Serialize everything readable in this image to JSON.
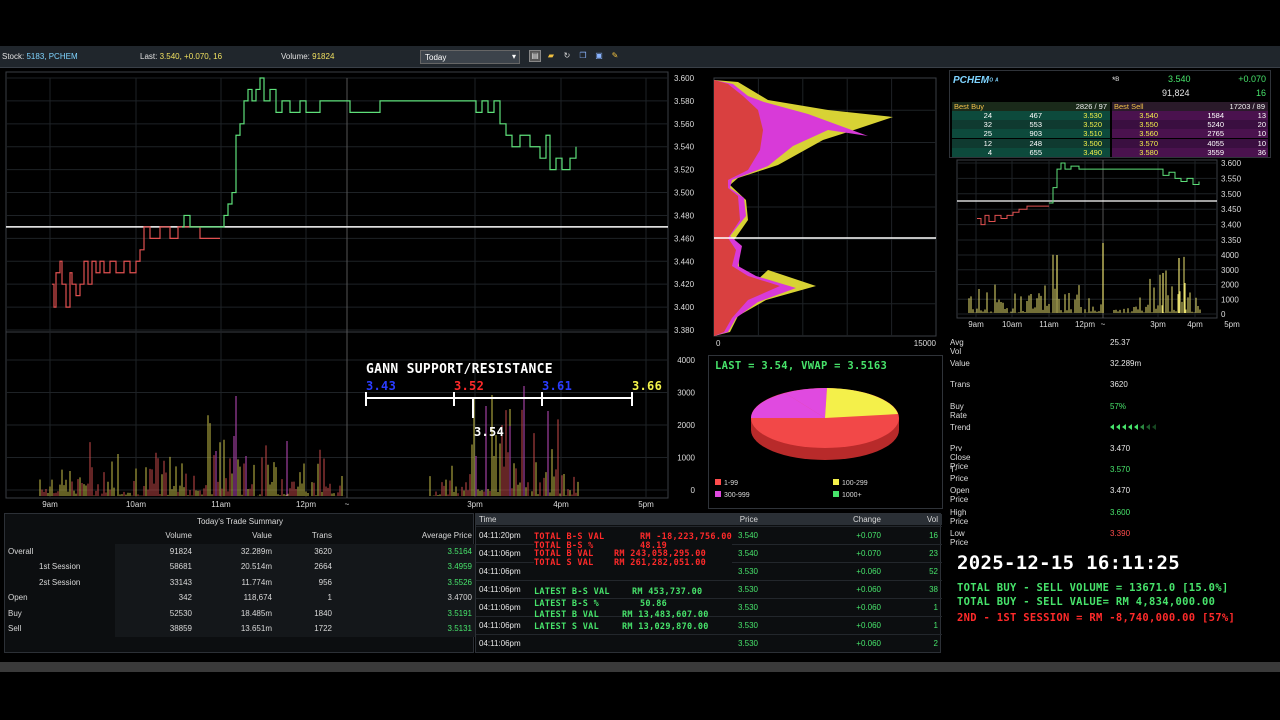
{
  "header": {
    "stock_label": "Stock:",
    "stock_value": "5183,  PCHEM",
    "last_label": "Last:",
    "last_value": "3.540, +0.070, 16",
    "volume_label": "Volume:",
    "volume_value": "91824",
    "period_select": "Today"
  },
  "main_chart": {
    "price_ticks": [
      "3.600",
      "3.580",
      "3.560",
      "3.540",
      "3.520",
      "3.500",
      "3.480",
      "3.460",
      "3.440",
      "3.420",
      "3.400",
      "3.380"
    ],
    "volume_ticks": [
      "4000",
      "3000",
      "2000",
      "1000",
      "0"
    ],
    "time_ticks": [
      "9am",
      "10am",
      "11am",
      "12pm",
      "~",
      "3pm",
      "4pm",
      "5pm"
    ],
    "reference_price": 3.47
  },
  "gann": {
    "title": "GANN SUPPORT/RESISTANCE",
    "levels": [
      "3.43",
      "3.52",
      "3.61",
      "3.66"
    ],
    "current": "3.54",
    "colors": {
      "level1": "#2a3cff",
      "level2": "#ff2a2a",
      "level3": "#2a3cff",
      "level4": "#f2f24a"
    }
  },
  "volume_profile": {
    "x_ticks": [
      "0",
      "15000"
    ]
  },
  "pie": {
    "title": "LAST = 3.54, VWAP = 3.5163",
    "legend": [
      {
        "label": "1-99",
        "color": "#ff4d4d"
      },
      {
        "label": "100-299",
        "color": "#f4f04a"
      },
      {
        "label": "300-999",
        "color": "#e04ae0"
      },
      {
        "label": "1000+",
        "color": "#47e36b"
      }
    ]
  },
  "summary": {
    "title": "Today's Trade Summary",
    "columns": [
      "",
      "Volume",
      "Value",
      "Trans",
      "Average Price"
    ],
    "rows": [
      {
        "label": "Overall",
        "volume": "91824",
        "value": "32.289m",
        "trans": "3620",
        "avg": "3.5164"
      },
      {
        "label": "1st Session",
        "volume": "58681",
        "value": "20.514m",
        "trans": "2664",
        "avg": "3.4959"
      },
      {
        "label": "2st Session",
        "volume": "33143",
        "value": "11.774m",
        "trans": "956",
        "avg": "3.5526"
      },
      {
        "label": "Open",
        "volume": "342",
        "value": "118,674",
        "trans": "1",
        "avg": "3.4700"
      },
      {
        "label": "Buy",
        "volume": "52530",
        "value": "18.485m",
        "trans": "1840",
        "avg": "3.5191"
      },
      {
        "label": "Sell",
        "volume": "38859",
        "value": "13.651m",
        "trans": "1722",
        "avg": "3.5131"
      }
    ]
  },
  "trades": {
    "columns": [
      "Time",
      "Price",
      "Change",
      "Vol"
    ],
    "rows": [
      {
        "time": "04:11:20pm",
        "price": "3.540",
        "change": "+0.070",
        "vol": "16"
      },
      {
        "time": "04:11:06pm",
        "price": "3.540",
        "change": "+0.070",
        "vol": "23"
      },
      {
        "time": "04:11:06pm",
        "price": "3.530",
        "change": "+0.060",
        "vol": "52"
      },
      {
        "time": "04:11:06pm",
        "price": "3.530",
        "change": "+0.060",
        "vol": "38"
      },
      {
        "time": "04:11:06pm",
        "price": "3.530",
        "change": "+0.060",
        "vol": "1"
      },
      {
        "time": "04:11:06pm",
        "price": "3.530",
        "change": "+0.060",
        "vol": "1"
      },
      {
        "time": "04:11:06pm",
        "price": "3.530",
        "change": "+0.060",
        "vol": "2"
      }
    ],
    "overlay_totals": [
      {
        "label": "TOTAL B-S VAL",
        "value": "RM -18,223,756.00"
      },
      {
        "label": "TOTAL B-S %",
        "value": "48.19"
      },
      {
        "label": "TOTAL B VAL",
        "value": "RM 243,058,295.00"
      },
      {
        "label": "TOTAL S VAL",
        "value": "RM 261,282,051.00"
      }
    ],
    "overlay_latest": [
      {
        "label": "LATEST B-S VAL",
        "value": "RM 453,737.00"
      },
      {
        "label": "LATEST B-S %",
        "value": "50.86"
      },
      {
        "label": "LATEST B VAL",
        "value": "RM 13,483,607.00"
      },
      {
        "label": "LATEST S VAL",
        "value": "RM 13,029,870.00"
      }
    ]
  },
  "quote": {
    "name": "PCHEM",
    "suffix": "ᴼ ᴬ",
    "flag": "*ᴮ",
    "last": "3.540",
    "change": "+0.070",
    "volume": "91,824",
    "last_vol": "16",
    "best_buy_label": "Best Buy",
    "best_buy_total": "2826 / 97",
    "best_sell_label": "Best Sell",
    "best_sell_total": "17203 / 89",
    "depth": [
      {
        "bq": "24",
        "bv": "467",
        "bp": "3.530",
        "sp": "3.540",
        "sv": "1584",
        "sq": "13"
      },
      {
        "bq": "32",
        "bv": "553",
        "bp": "3.520",
        "sp": "3.550",
        "sv": "5240",
        "sq": "20"
      },
      {
        "bq": "25",
        "bv": "903",
        "bp": "3.510",
        "sp": "3.560",
        "sv": "2765",
        "sq": "10"
      },
      {
        "bq": "12",
        "bv": "248",
        "bp": "3.500",
        "sp": "3.570",
        "sv": "4055",
        "sq": "10"
      },
      {
        "bq": "4",
        "bv": "655",
        "bp": "3.490",
        "sp": "3.580",
        "sv": "3559",
        "sq": "36"
      }
    ]
  },
  "mini_chart": {
    "price_ticks": [
      "3.600",
      "3.550",
      "3.500",
      "3.450",
      "3.400",
      "3.350"
    ],
    "volume_ticks": [
      "4000",
      "3000",
      "2000",
      "1000",
      "0"
    ],
    "time_ticks": [
      "9am",
      "10am",
      "11am",
      "12pm",
      "~",
      "3pm",
      "4pm",
      "5pm"
    ]
  },
  "stats": [
    {
      "label": "Avg Vol",
      "value": "25.37",
      "color": "#e6e6e6"
    },
    {
      "label": "Value",
      "value": "32.289m",
      "color": "#e6e6e6"
    },
    {
      "label": "Trans",
      "value": "3620",
      "color": "#e6e6e6"
    },
    {
      "label": "Buy Rate",
      "value": "57%",
      "color": "#47e36b"
    },
    {
      "label": "Trend",
      "value": "",
      "color": "#47e36b"
    },
    {
      "label": "Prv Close Price",
      "value": "3.470",
      "color": "#e6e6e6"
    },
    {
      "label": "T-Price",
      "value": "3.570",
      "color": "#47e36b"
    },
    {
      "label": "Open Price",
      "value": "3.470",
      "color": "#e6e6e6"
    },
    {
      "label": "High Price",
      "value": "3.600",
      "color": "#47e36b"
    },
    {
      "label": "Low Price",
      "value": "3.390",
      "color": "#ff4d4d"
    }
  ],
  "overlay_info": {
    "datetime": "2025-12-15 16:11:25",
    "line1": "TOTAL BUY - SELL VOLUME = 13671.0 [15.0%]",
    "line2": "TOTAL BUY - SELL VALUE= RM 4,834,000.00",
    "line3": "2ND - 1ST SESSION = RM -8,740,000.00 [57%]"
  }
}
